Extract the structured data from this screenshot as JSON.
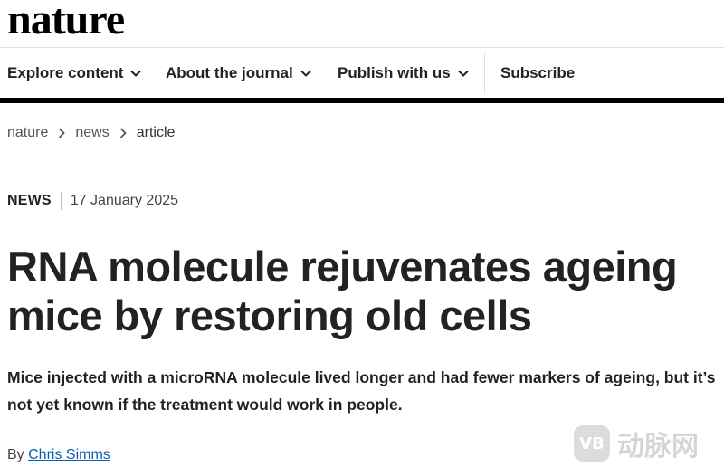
{
  "site": {
    "logo": "nature"
  },
  "nav": {
    "items": [
      {
        "label": "Explore content"
      },
      {
        "label": "About the journal"
      },
      {
        "label": "Publish with us"
      }
    ],
    "subscribe": "Subscribe"
  },
  "breadcrumb": {
    "items": [
      "nature",
      "news"
    ],
    "current": "article"
  },
  "article": {
    "type": "NEWS",
    "date": "17 January 2025",
    "title": "RNA molecule rejuvenates ageing mice by restoring old cells",
    "standfirst": "Mice injected with a microRNA molecule lived longer and had fewer markers of ageing, but it’s not yet known if the treatment would work in people.",
    "byline_prefix": "By",
    "author": "Chris Simms"
  },
  "watermark": {
    "badge": "VB",
    "text": "动脉网"
  },
  "icons": {
    "nav_chevron": "chevron-down-icon",
    "breadcrumb_sep": "chevron-right-icon"
  }
}
